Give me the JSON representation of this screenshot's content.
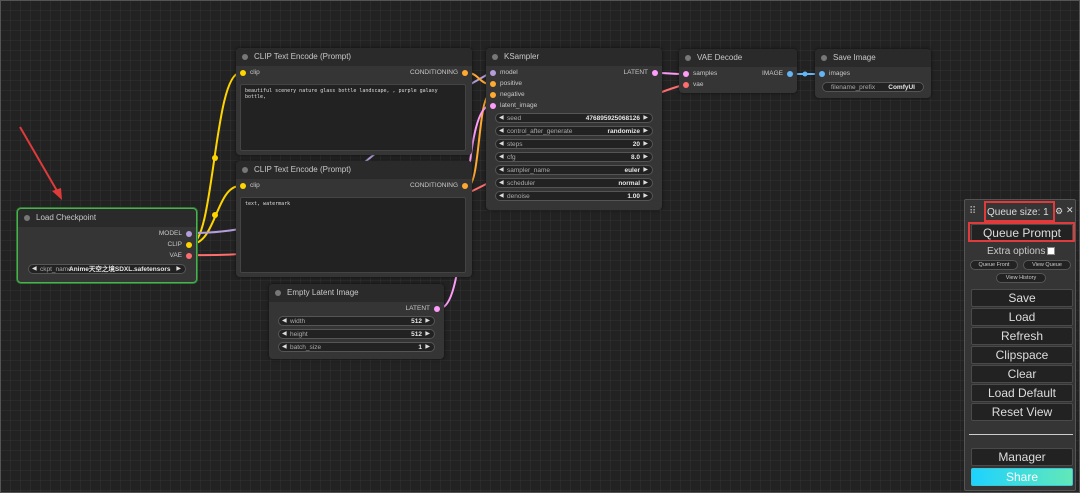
{
  "nodes": {
    "load_checkpoint": {
      "title": "Load Checkpoint",
      "outputs": [
        "MODEL",
        "CLIP",
        "VAE"
      ],
      "ckpt_label": "ckpt_name",
      "ckpt_value": "Anime天空之境SDXL.safetensors"
    },
    "clip_pos": {
      "title": "CLIP Text Encode (Prompt)",
      "input": "clip",
      "output": "CONDITIONING",
      "text": "beautiful scenery nature glass bottle landscape, , purple galaxy bottle,"
    },
    "clip_neg": {
      "title": "CLIP Text Encode (Prompt)",
      "input": "clip",
      "output": "CONDITIONING",
      "text": "text, watermark"
    },
    "empty_latent": {
      "title": "Empty Latent Image",
      "output": "LATENT",
      "widgets": [
        {
          "label": "width",
          "value": "512"
        },
        {
          "label": "height",
          "value": "512"
        },
        {
          "label": "batch_size",
          "value": "1"
        }
      ]
    },
    "ksampler": {
      "title": "KSampler",
      "inputs": [
        "model",
        "positive",
        "negative",
        "latent_image"
      ],
      "output": "LATENT",
      "widgets": [
        {
          "label": "seed",
          "value": "476895925068126"
        },
        {
          "label": "control_after_generate",
          "value": "randomize"
        },
        {
          "label": "steps",
          "value": "20"
        },
        {
          "label": "cfg",
          "value": "8.0"
        },
        {
          "label": "sampler_name",
          "value": "euler"
        },
        {
          "label": "scheduler",
          "value": "normal"
        },
        {
          "label": "denoise",
          "value": "1.00"
        }
      ]
    },
    "vae_decode": {
      "title": "VAE Decode",
      "inputs": [
        "samples",
        "vae"
      ],
      "output": "IMAGE"
    },
    "save_image": {
      "title": "Save Image",
      "input": "images",
      "prefix_label": "filename_prefix",
      "prefix_value": "ComfyUI"
    }
  },
  "menu": {
    "queue_size": "Queue size: 1",
    "queue_prompt": "Queue Prompt",
    "extra_options": "Extra options",
    "queue_front": "Queue Front",
    "view_queue": "View Queue",
    "view_history": "View History",
    "save": "Save",
    "load": "Load",
    "refresh": "Refresh",
    "clipspace": "Clipspace",
    "clear": "Clear",
    "load_default": "Load Default",
    "reset_view": "Reset View",
    "manager": "Manager",
    "share": "Share",
    "drag_icon": "⠿",
    "gear_icon": "⚙",
    "close_icon": "✕"
  },
  "colors": {
    "model": "#b39ddb",
    "clip": "#ffd500",
    "vae": "#ff6e6e",
    "conditioning": "#ffa931",
    "latent": "#ff9cf9",
    "image": "#64b5f6",
    "annotation": "#e03a3a",
    "selected": "#4caf50"
  }
}
